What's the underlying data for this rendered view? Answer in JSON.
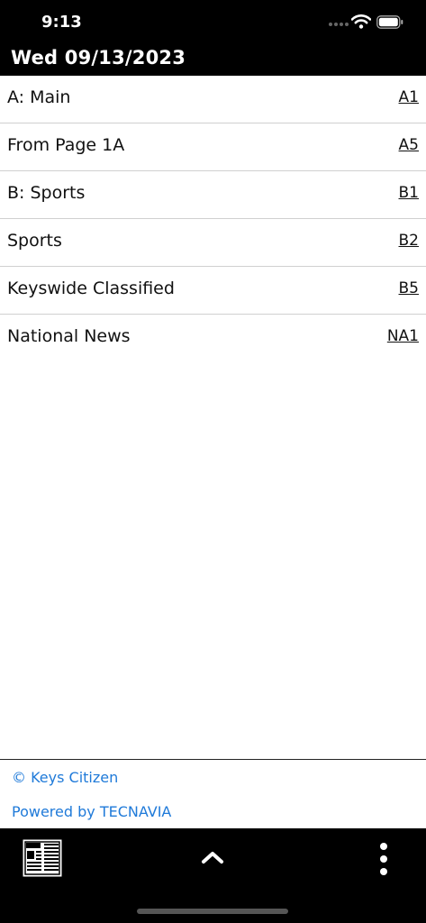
{
  "status": {
    "time": "9:13"
  },
  "header": {
    "date": "Wed 09/13/2023"
  },
  "sections": [
    {
      "name": "A: Main",
      "page": "A1"
    },
    {
      "name": "From Page 1A",
      "page": "A5"
    },
    {
      "name": "B: Sports",
      "page": "B1"
    },
    {
      "name": "Sports",
      "page": "B2"
    },
    {
      "name": "Keyswide Classified",
      "page": "B5"
    },
    {
      "name": "National News",
      "page": "NA1"
    }
  ],
  "footer": {
    "copyright": "© Keys Citizen",
    "powered_by": "Powered by TECNAVIA",
    "link_color": "#1f7ad9"
  },
  "toolbar": {
    "icons": [
      "news-icon",
      "chevron-up-icon",
      "more-vertical-icon"
    ]
  }
}
